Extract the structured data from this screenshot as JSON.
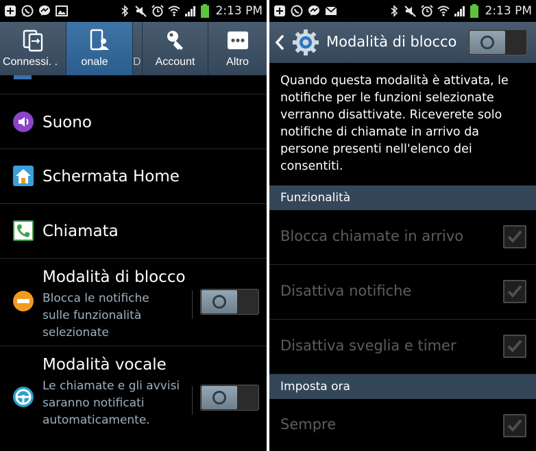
{
  "status_bar": {
    "time": "2:13 PM",
    "left_icons_left": [
      "add-icon",
      "whatsapp-icon",
      "messenger-icon",
      "image-icon"
    ],
    "left_icons_right": [
      "add-icon",
      "whatsapp-icon",
      "messenger-icon",
      "gmail-icon"
    ],
    "right_icons": [
      "bluetooth-icon",
      "mute-icon",
      "alarm-icon",
      "wifi-icon",
      "signal-icon",
      "battery-icon"
    ]
  },
  "left": {
    "tabs": [
      {
        "label": "Connessi. .",
        "icon": "connections-icon",
        "active": false
      },
      {
        "label": "onale",
        "icon": "personal-icon",
        "active": true
      },
      {
        "label": "D",
        "icon": "",
        "active": false
      },
      {
        "label": "Account",
        "icon": "key-icon",
        "active": false
      },
      {
        "label": "Altro",
        "icon": "more-icon",
        "active": false
      }
    ],
    "items": {
      "sound": {
        "title": "Suono",
        "icon": "sound-icon"
      },
      "home": {
        "title": "Schermata Home",
        "icon": "home-icon"
      },
      "call": {
        "title": "Chiamata",
        "icon": "phone-icon"
      },
      "block": {
        "title": "Modalità di blocco",
        "summary": "Blocca le notifiche sulle funzionalità selezionate",
        "icon": "block-mode-icon",
        "enabled": false
      },
      "voice": {
        "title": "Modalità vocale",
        "summary": "Le chiamate e gli avvisi saranno notificati automaticamente.",
        "icon": "steering-wheel-icon",
        "enabled": false
      }
    }
  },
  "right": {
    "header": {
      "title": "Modalità di blocco",
      "enabled": false
    },
    "description": "Quando questa modalità è attivata, le notifiche per le funzioni selezionate verranno disattivate. Riceverete solo notifiche di chiamate in arrivo da persone presenti nell'elenco dei consentiti.",
    "sections": {
      "features": {
        "header": "Funzionalità"
      },
      "schedule": {
        "header": "Imposta ora"
      }
    },
    "options": {
      "block_calls": {
        "label": "Blocca chiamate in arrivo",
        "checked": true
      },
      "disable_notifications": {
        "label": "Disattiva notifiche",
        "checked": true
      },
      "disable_alarm": {
        "label": "Disattiva sveglia e timer",
        "checked": true
      },
      "always": {
        "label": "Sempre",
        "checked": true
      }
    }
  },
  "colors": {
    "accent_blue": "#2b5d8e",
    "header": "#34475a",
    "disabled_text": "#5d5d5d",
    "summary_text": "#9fb0bf"
  }
}
